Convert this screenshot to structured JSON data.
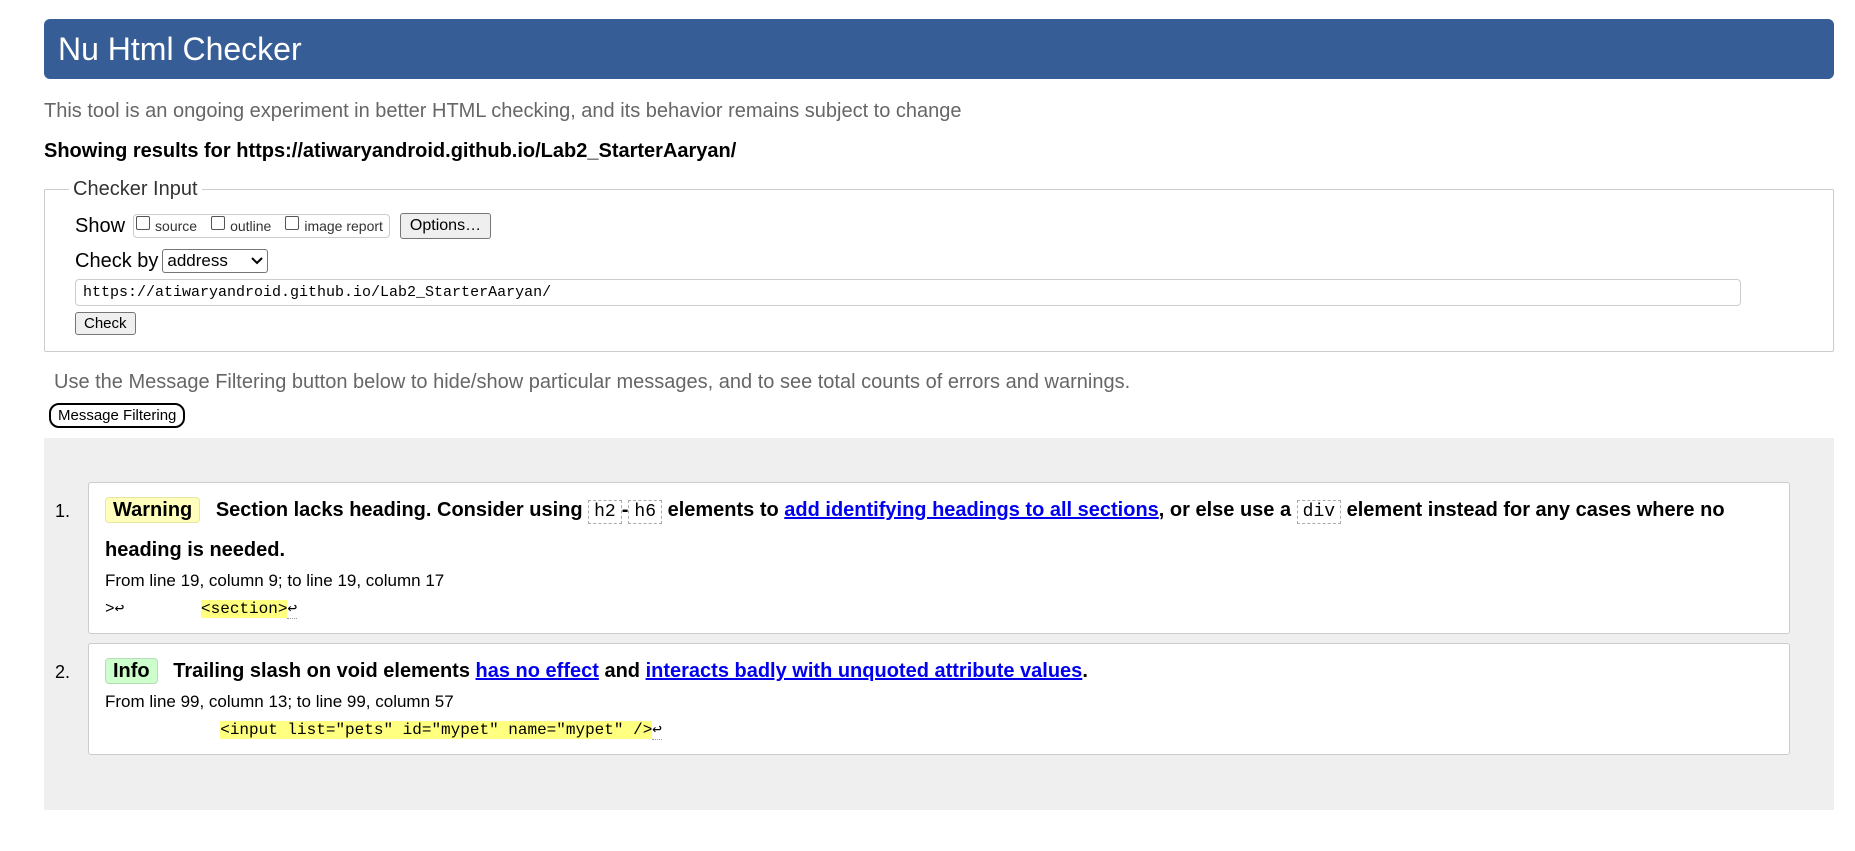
{
  "header": {
    "title": "Nu Html Checker"
  },
  "subtitle": "This tool is an ongoing experiment in better HTML checking, and its behavior remains subject to change",
  "results_for": "Showing results for https://atiwaryandroid.github.io/Lab2_StarterAaryan/",
  "checker_input": {
    "legend": "Checker Input",
    "show_label": "Show",
    "show_options": [
      {
        "label": "source",
        "checked": false
      },
      {
        "label": "outline",
        "checked": false
      },
      {
        "label": "image report",
        "checked": false
      }
    ],
    "options_button": "Options…",
    "check_by_label": "Check by",
    "check_by_value": "address",
    "url_value": "https://atiwaryandroid.github.io/Lab2_StarterAaryan/",
    "check_button": "Check"
  },
  "filter_note": "Use the Message Filtering button below to hide/show particular messages, and to see total counts of errors and warnings.",
  "filter_button": "Message Filtering",
  "messages": [
    {
      "number": "1.",
      "type": "Warning",
      "text_1": "Section lacks heading. Consider using",
      "code_1": "h2",
      "dash": "-",
      "code_2": "h6",
      "text_2": "elements to",
      "link_1": "add identifying headings to all sections",
      "text_3": ", or else use a",
      "code_3": "div",
      "text_4": "element instead for any cases where no heading is needed.",
      "location": "From line 19, column 9; to line 19, column 17",
      "extract_before": ">↩        ",
      "extract_highlight": "<section>",
      "extract_after": "↩"
    },
    {
      "number": "2.",
      "type": "Info",
      "text_1": "Trailing slash on void elements",
      "link_1": "has no effect",
      "text_2": "and",
      "link_2": "interacts badly with unquoted attribute values",
      "text_3": ".",
      "location": "From line 99, column 13; to line 99, column 57",
      "extract_before": "            ",
      "extract_highlight": "<input list=\"pets\" id=\"mypet\" name=\"mypet\" />",
      "extract_after": "↩"
    }
  ],
  "colors": {
    "header_bg": "#365d95",
    "warning_bg": "#ffffbb",
    "info_bg": "#ccffcc",
    "highlight": "#ffff80",
    "results_bg": "#efefef",
    "link": "#0000ee"
  }
}
